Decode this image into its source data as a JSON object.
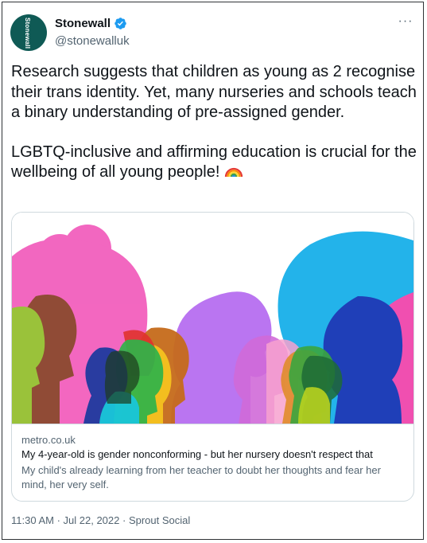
{
  "account": {
    "display_name": "Stonewall",
    "handle": "@stonewalluk",
    "avatar_text": "Stonewall"
  },
  "menu": {
    "more_label": "···"
  },
  "tweet": {
    "paragraph_1": "Research suggests that children as young as 2 recognise their trans identity. Yet, many nurseries and schools teach a binary understanding of pre-assigned gender.",
    "paragraph_2": "LGBTQ-inclusive and affirming education is crucial for the wellbeing of all young people!",
    "emoji_icon": "rainbow-icon"
  },
  "card": {
    "domain": "metro.co.uk",
    "title": "My 4-year-old is gender nonconforming - but her nursery doesn't respect that",
    "description": "My child's already learning from her teacher to doubt her thoughts and fear her mind, her very self."
  },
  "footer": {
    "time": "11:30 AM",
    "separator_1": " · ",
    "date": "Jul 22, 2022",
    "separator_2": " · ",
    "source": "Sprout Social"
  },
  "colors": {
    "verified_blue": "#1d9bf0",
    "avatar_bg": "#0f5a55",
    "secondary_text": "#536471",
    "border": "#cfd9de"
  }
}
